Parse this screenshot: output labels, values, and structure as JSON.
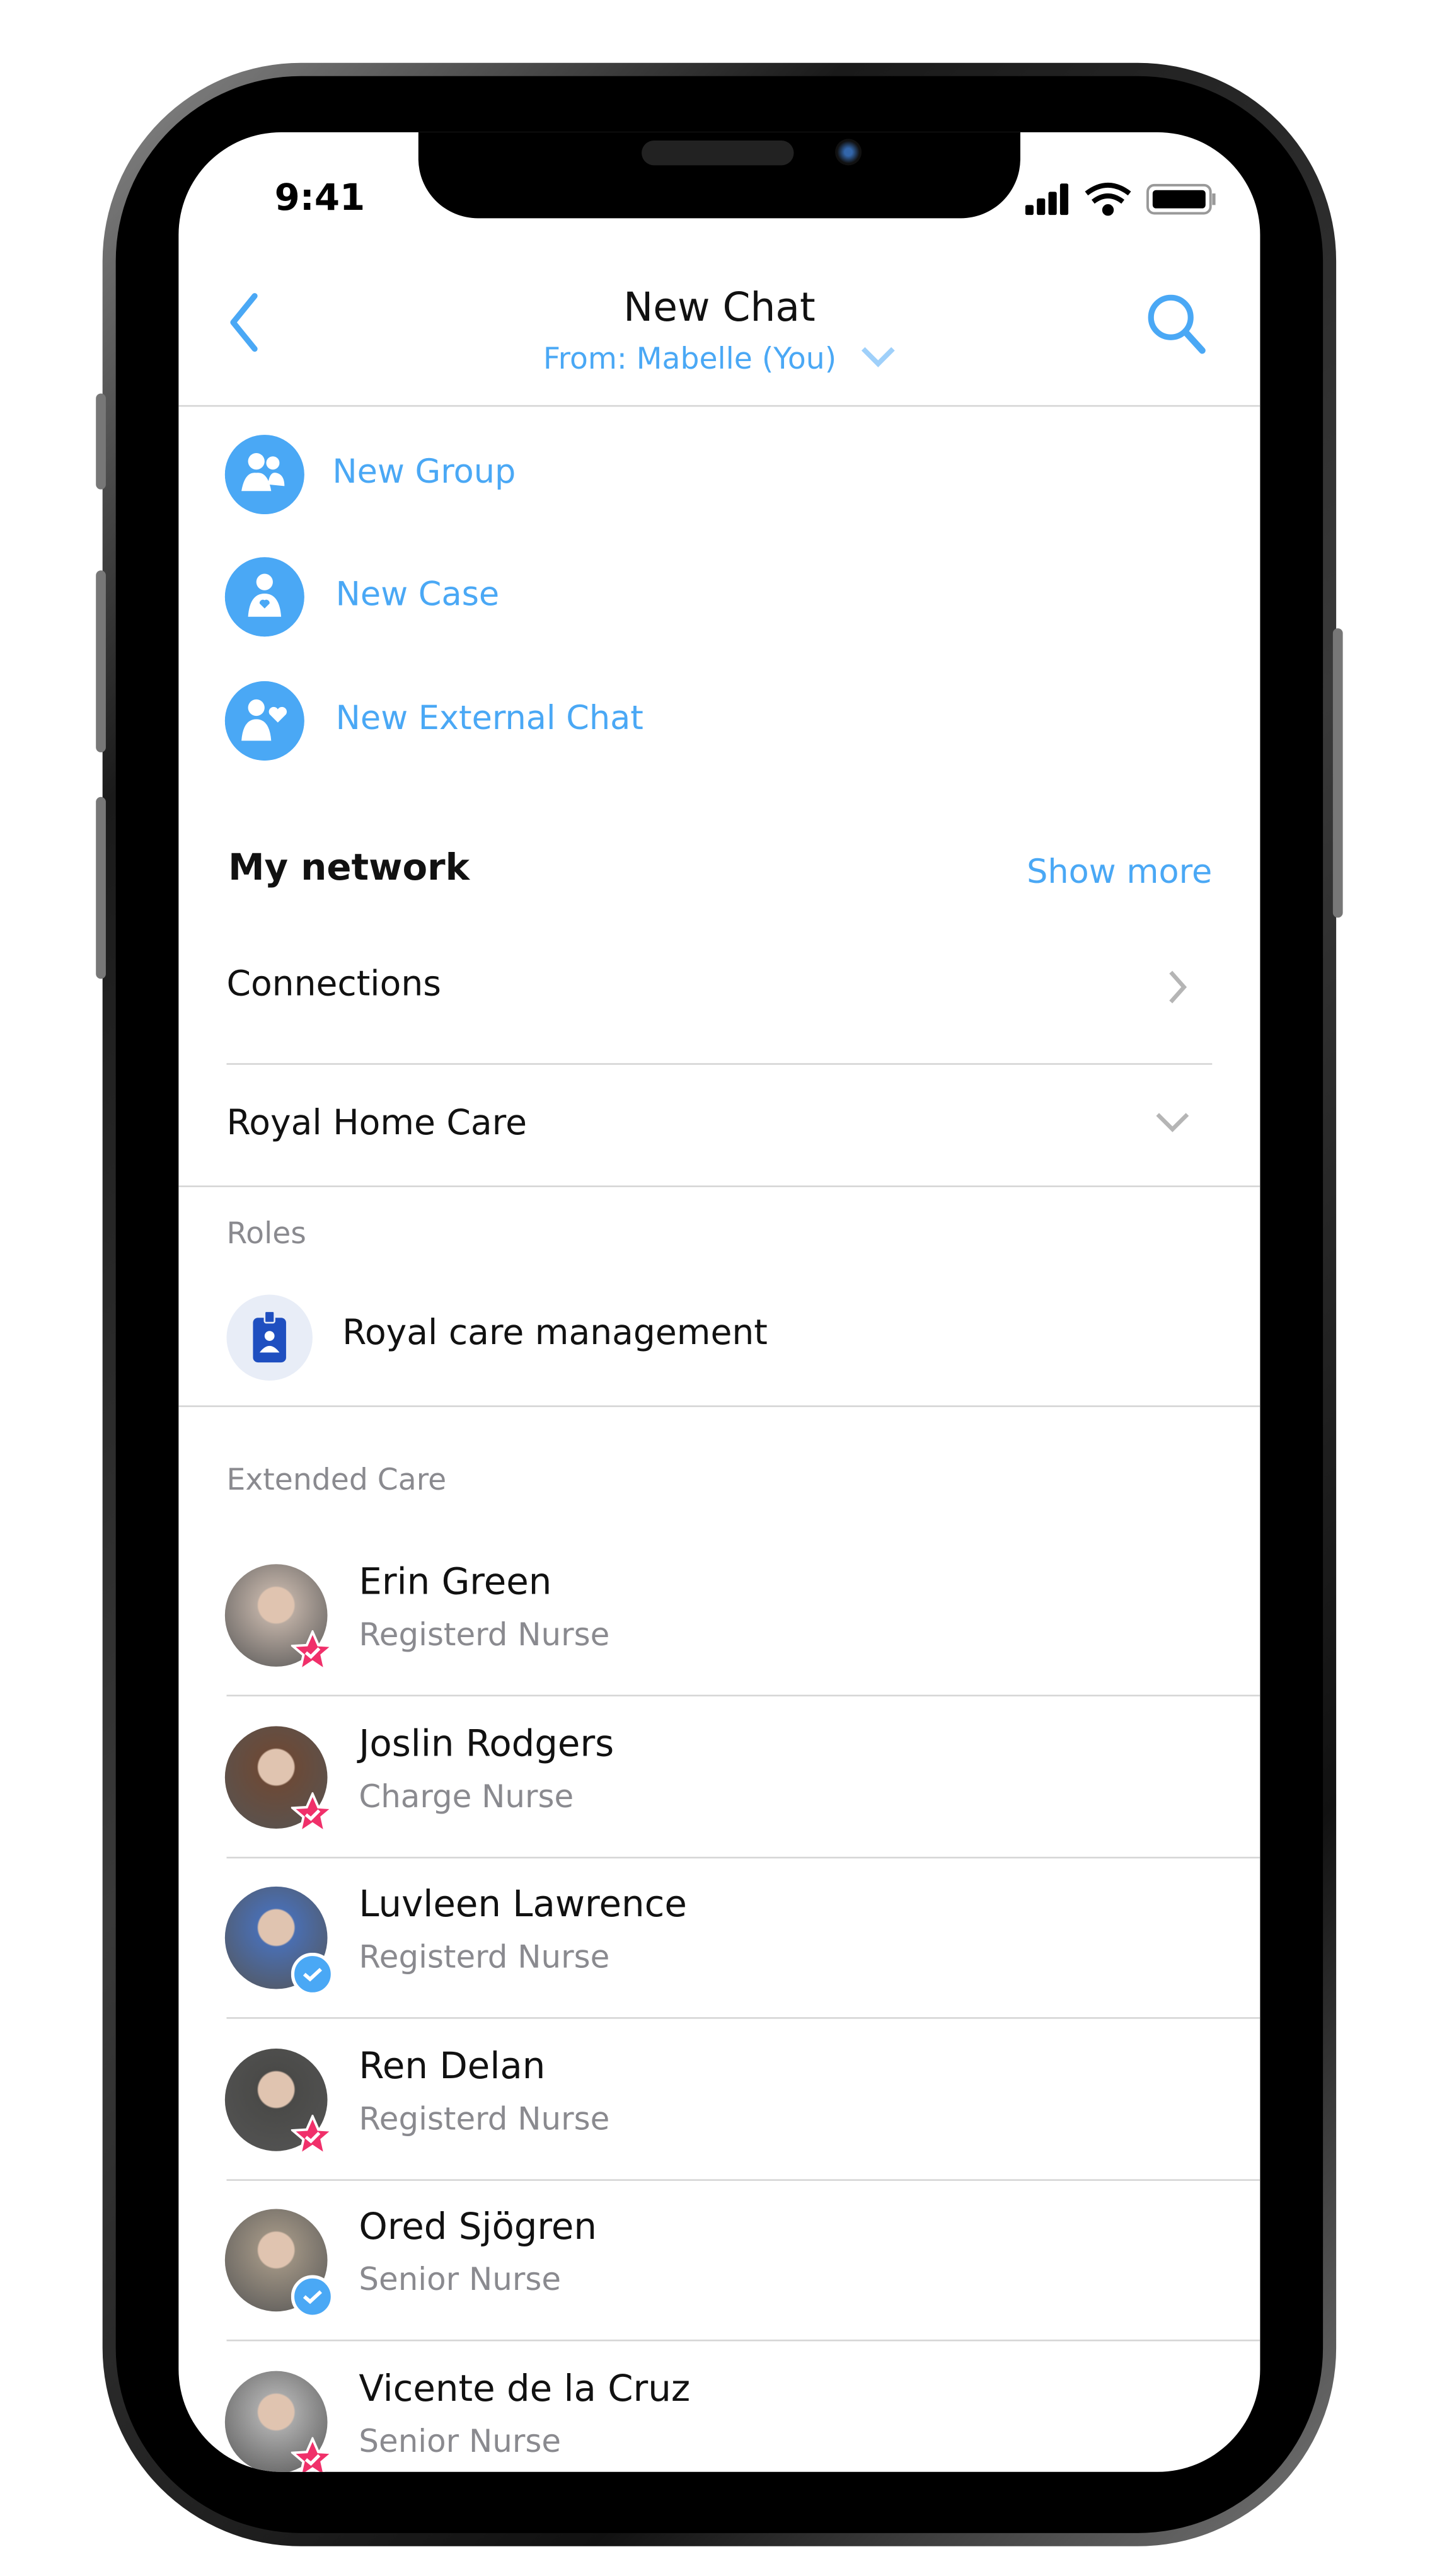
{
  "status_bar": {
    "time": "9:41",
    "icons": [
      "signal-icon",
      "wifi-icon",
      "battery-icon"
    ]
  },
  "header": {
    "title": "New Chat",
    "from_label": "From: Mabelle (You)",
    "back_icon": "chevron-left-icon",
    "search_icon": "search-icon"
  },
  "actions": [
    {
      "label": "New Group",
      "icon": "group-icon"
    },
    {
      "label": "New Case",
      "icon": "case-icon"
    },
    {
      "label": "New External Chat",
      "icon": "external-chat-icon"
    }
  ],
  "network": {
    "title": "My network",
    "show_more": "Show more",
    "connections": "Connections",
    "organization": "Royal Home Care"
  },
  "roles": {
    "header": "Roles",
    "items": [
      {
        "label": "Royal care management",
        "icon": "badge-icon"
      }
    ]
  },
  "extended_care": {
    "header": "Extended Care",
    "people": [
      {
        "name": "Erin Green",
        "role": "Registerd Nurse",
        "badge": "star",
        "avatar_color": "#b8aaa0"
      },
      {
        "name": "Joslin Rodgers",
        "role": "Charge Nurse",
        "badge": "star",
        "avatar_color": "#6b4a38"
      },
      {
        "name": "Luvleen Lawrence",
        "role": "Registerd Nurse",
        "badge": "check",
        "avatar_color": "#4a6eb0"
      },
      {
        "name": "Ren Delan",
        "role": "Registerd Nurse",
        "badge": "star",
        "avatar_color": "#4a4a48"
      },
      {
        "name": "Ored Sjögren",
        "role": "Senior Nurse",
        "badge": "check",
        "avatar_color": "#9a8f80"
      },
      {
        "name": "Vicente de la Cruz",
        "role": "Senior Nurse",
        "badge": "star",
        "avatar_color": "#a8a8a8"
      }
    ]
  },
  "colors": {
    "accent": "#4aa8f5",
    "star_badge": "#f0306a",
    "text_gray": "#8a8a8f"
  }
}
